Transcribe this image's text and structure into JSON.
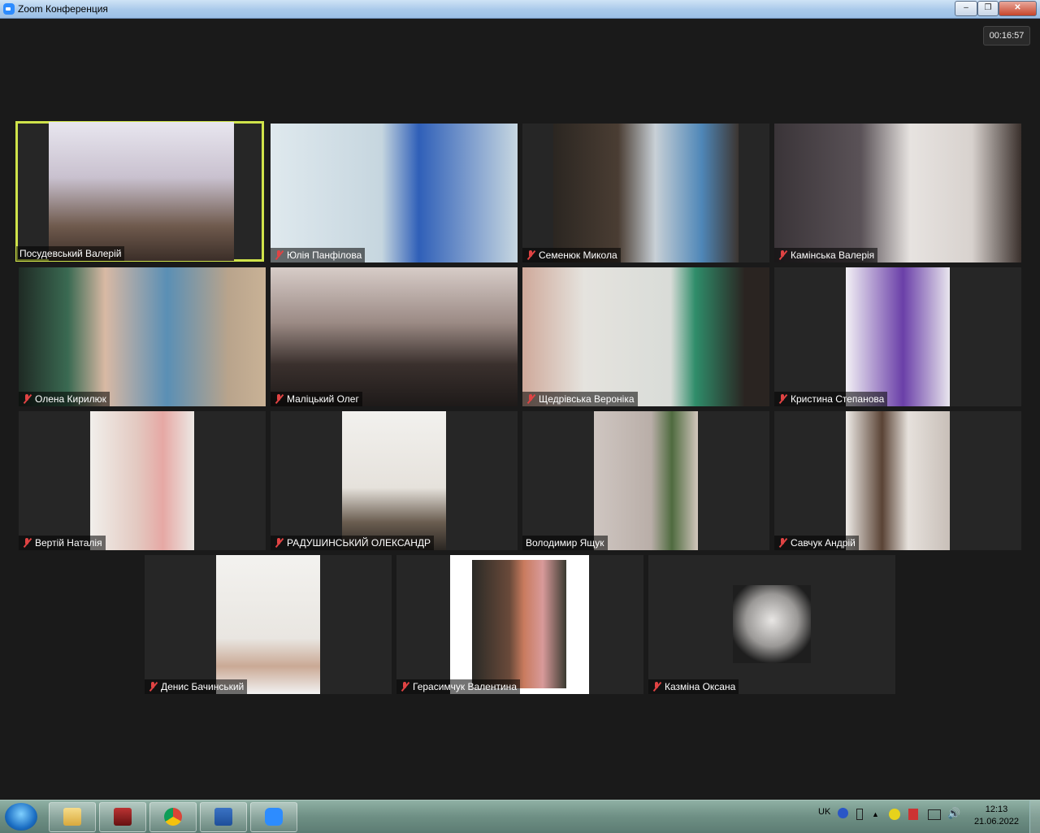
{
  "window": {
    "title": "Zoom Конференция",
    "minimize": "‒",
    "maximize": "❐",
    "close": "✕"
  },
  "meeting": {
    "timer": "00:16:57"
  },
  "participants": [
    {
      "name": "Посудевський Валерій",
      "muted": false
    },
    {
      "name": "Юлія Панфілова",
      "muted": true
    },
    {
      "name": "Семенюк Микола",
      "muted": true
    },
    {
      "name": "Камінська Валерія",
      "muted": true
    },
    {
      "name": "Олена Кирилюк",
      "muted": true
    },
    {
      "name": "Маліцький Олег",
      "muted": true
    },
    {
      "name": "Щедрівська Вероніка",
      "muted": true
    },
    {
      "name": "Кристина  Степанова",
      "muted": true
    },
    {
      "name": "Вертій Наталія",
      "muted": true
    },
    {
      "name": "РАДУШИНСЬКИЙ ОЛЕКСАНДР",
      "muted": true
    },
    {
      "name": "Володимир Ящук",
      "muted": false
    },
    {
      "name": "Савчук Андрій",
      "muted": true
    },
    {
      "name": "Денис Бачинський",
      "muted": true
    },
    {
      "name": "Герасимчук Валентина",
      "muted": true
    },
    {
      "name": "Казміна Оксана",
      "muted": true
    }
  ],
  "taskbar": {
    "apps": [
      "explorer",
      "media-app",
      "chrome",
      "word",
      "zoom"
    ],
    "language": "UK",
    "time": "12:13",
    "date": "21.06.2022"
  },
  "colors": {
    "active_speaker_border": "#cfe34a",
    "muted_icon": "#e04343",
    "meeting_bg": "#1a1a1a"
  }
}
